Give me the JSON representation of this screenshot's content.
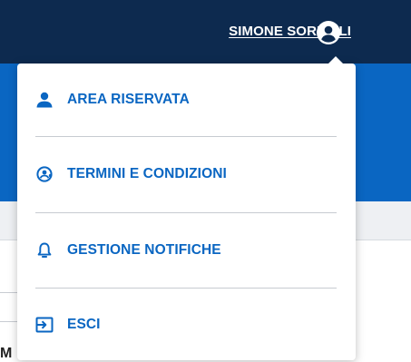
{
  "header": {
    "user_name": "SIMONE SORDILLI",
    "avatar_icon": "user-circle-icon",
    "background_color": "#0d2a4f"
  },
  "background": {
    "partial_text": "M"
  },
  "user_menu": {
    "items": [
      {
        "label": "AREA RISERVATA",
        "icon": "user-icon"
      },
      {
        "label": "TERMINI E CONDIZIONI",
        "icon": "terms-user-icon"
      },
      {
        "label": "GESTIONE NOTIFICHE",
        "icon": "bell-icon"
      },
      {
        "label": "ESCI",
        "icon": "logout-icon"
      }
    ],
    "accent_color": "#0a66c2"
  }
}
